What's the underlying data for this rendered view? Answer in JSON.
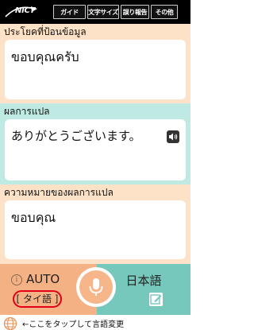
{
  "app": {
    "logo_text": "NICT"
  },
  "menu": [
    {
      "label": "ガイド"
    },
    {
      "label": "文字サイズ"
    },
    {
      "label": "誤り報告"
    },
    {
      "label": "その他"
    }
  ],
  "input_section": {
    "label": "ประโยคที่ป้อนข้อมูล",
    "text": "ขอบคุณครับ"
  },
  "translation_section": {
    "label": "ผลการแปล",
    "text": "ありがとうございます。"
  },
  "meaning_section": {
    "label": "ความหมายของผลการแปล",
    "text": "ขอบคุณ"
  },
  "controls": {
    "auto_label": "AUTO",
    "source_language": "[ タイ語 ]",
    "target_language": "日本語",
    "info_symbol": "i"
  },
  "footer": {
    "hint_text": "←ここをタップして言語変更"
  },
  "colors": {
    "topbar": "#000000",
    "section_peach": "#fde2c7",
    "section_teal": "#bfe9e3",
    "control_left": "#f4b183",
    "control_right": "#76c8bc",
    "language_ring": "#e0001a"
  }
}
